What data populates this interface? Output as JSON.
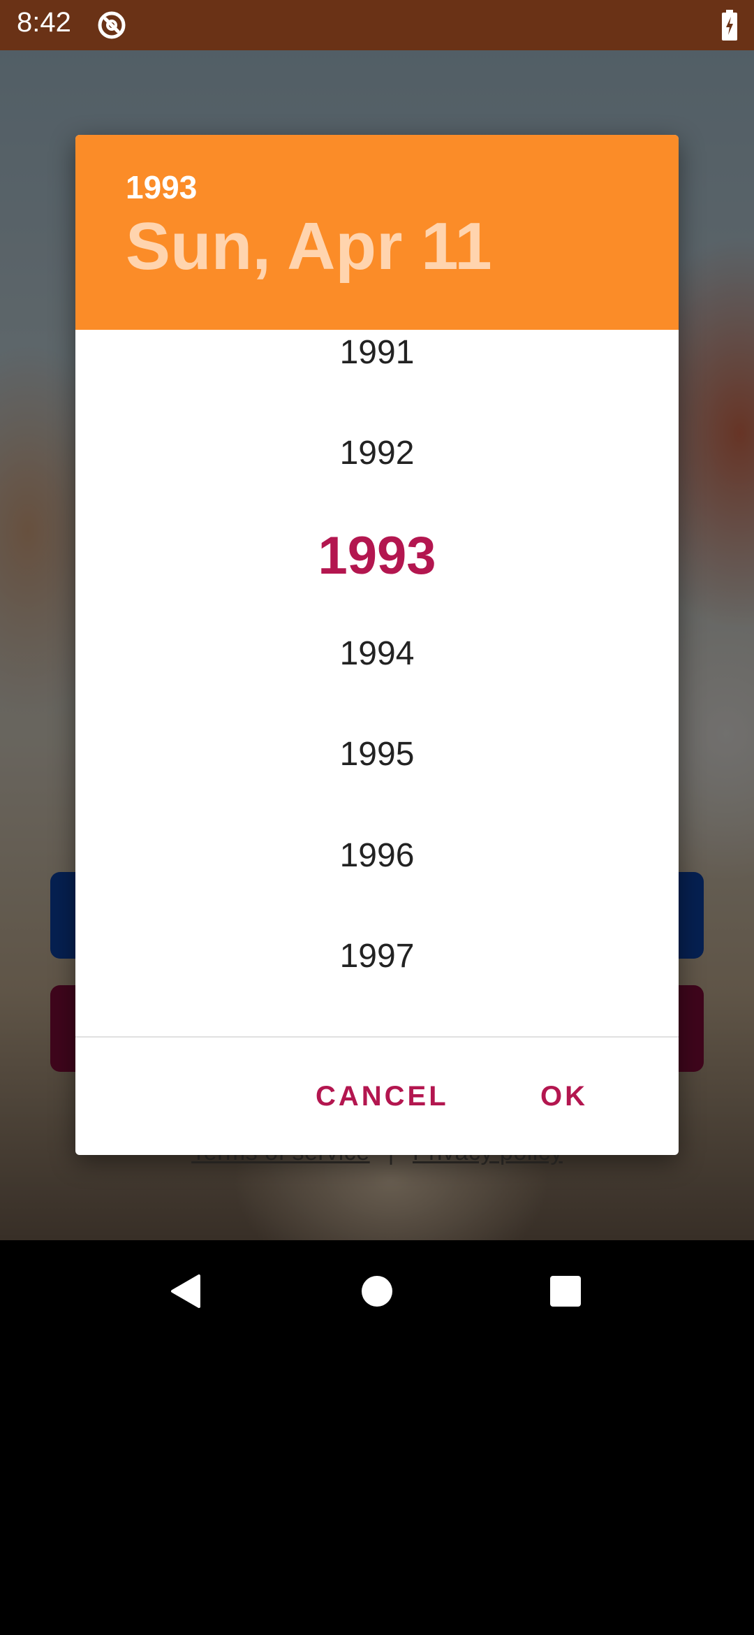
{
  "status_bar": {
    "time": "8:42",
    "app_icon": "sync-disabled-icon",
    "battery_icon": "battery-charging-icon"
  },
  "background": {
    "links": {
      "terms": "Terms of service",
      "separator": "|",
      "privacy": "Privacy policy"
    }
  },
  "date_picker": {
    "header": {
      "year": "1993",
      "date": "Sun, Apr 11"
    },
    "years": [
      {
        "label": "1991",
        "selected": false
      },
      {
        "label": "1992",
        "selected": false
      },
      {
        "label": "1993",
        "selected": true
      },
      {
        "label": "1994",
        "selected": false
      },
      {
        "label": "1995",
        "selected": false
      },
      {
        "label": "1996",
        "selected": false
      },
      {
        "label": "1997",
        "selected": false
      }
    ],
    "actions": {
      "cancel": "CANCEL",
      "ok": "OK"
    }
  },
  "navigation_bar": {
    "back": "back-icon",
    "home": "home-icon",
    "recents": "recents-icon"
  },
  "colors": {
    "header_background": "#fb8c28",
    "accent": "#b3164f",
    "header_date_text": "#ffd4ae"
  }
}
